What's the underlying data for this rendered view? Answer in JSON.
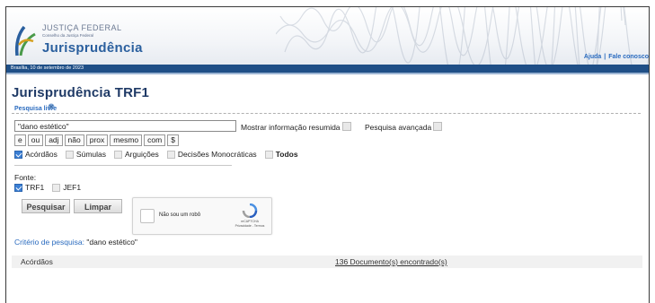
{
  "header": {
    "org_name": "JUSTIÇA FEDERAL",
    "org_subtitle": "Conselho da Justiça Federal",
    "app_title": "Jurisprudência",
    "date_text": "Brasília, 10 de setembro de 2023",
    "links": {
      "ajuda": "Ajuda",
      "separator": "|",
      "fale_conosco": "Fale conosco"
    }
  },
  "main": {
    "page_title": "Jurisprudência TRF1",
    "pesquisa_livre_label": "Pesquisa livre",
    "search": {
      "value": "\"dano estético\""
    },
    "mostrar_resumida_label": "Mostrar informação resumida",
    "pesquisa_avancada_label": "Pesquisa avançada",
    "operators": [
      "e",
      "ou",
      "adj",
      "não",
      "prox",
      "mesmo",
      "com",
      "$"
    ],
    "bases": [
      {
        "label": "Acórdãos",
        "checked": true
      },
      {
        "label": "Súmulas",
        "checked": false
      },
      {
        "label": "Arguições",
        "checked": false
      },
      {
        "label": "Decisões Monocráticas",
        "checked": false
      },
      {
        "label": "Todos",
        "checked": false
      }
    ],
    "fonte_label": "Fonte:",
    "fontes": [
      {
        "label": "TRF1",
        "checked": true
      },
      {
        "label": "JEF1",
        "checked": false
      }
    ],
    "buttons": {
      "pesquisar": "Pesquisar",
      "limpar": "Limpar"
    },
    "captcha": {
      "label": "Não sou um robô",
      "brand": "reCAPTCHA",
      "links": "Privacidade - Termos"
    },
    "criterio": {
      "label": "Critério de pesquisa:",
      "value": "\"dano estético\""
    },
    "results": {
      "label": "Acórdãos",
      "count_text": "136 Documento(s) encontrado(s)"
    }
  },
  "colors": {
    "accent": "#2a6bbf",
    "header_bar": "#1f4f87",
    "title": "#1f3a66"
  }
}
